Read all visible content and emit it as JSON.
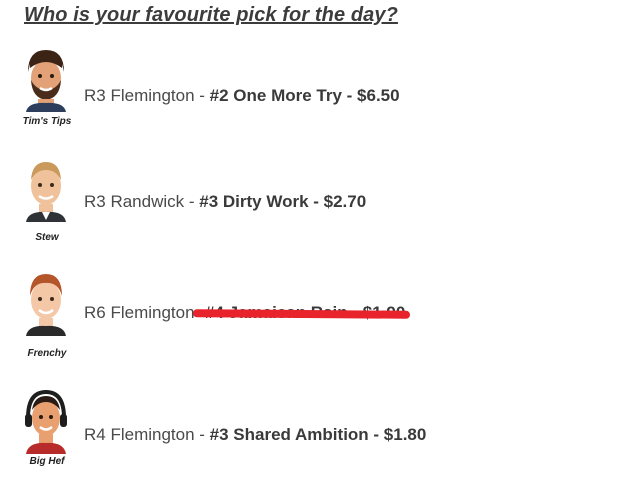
{
  "heading": "Who is your favourite pick for the day?",
  "picks": [
    {
      "tipster": "Tim's Tips",
      "race": "R3 Flemington",
      "separator": " - ",
      "selection": "#2 One More Try - $6.50",
      "scratched": false,
      "avatar_icon": "bearded-man-avatar-icon"
    },
    {
      "tipster": "Stew",
      "race": "R3 Randwick",
      "separator": " - ",
      "selection": "#3 Dirty Work - $2.70",
      "scratched": false,
      "avatar_icon": "blond-man-avatar-icon"
    },
    {
      "tipster": "Frenchy",
      "race": "R6 Flemington",
      "separator": " - ",
      "selection": "#4 Jamaican Rain - $1.90",
      "scratched": true,
      "avatar_icon": "redhead-man-avatar-icon"
    },
    {
      "tipster": "Big Hef",
      "race": "R4 Flemington",
      "separator": " - ",
      "selection": "#3 Shared Ambition - $1.80",
      "scratched": false,
      "avatar_icon": "headphones-man-avatar-icon"
    }
  ],
  "colors": {
    "scratch": "#e8232b",
    "text": "#3a3a3a"
  }
}
